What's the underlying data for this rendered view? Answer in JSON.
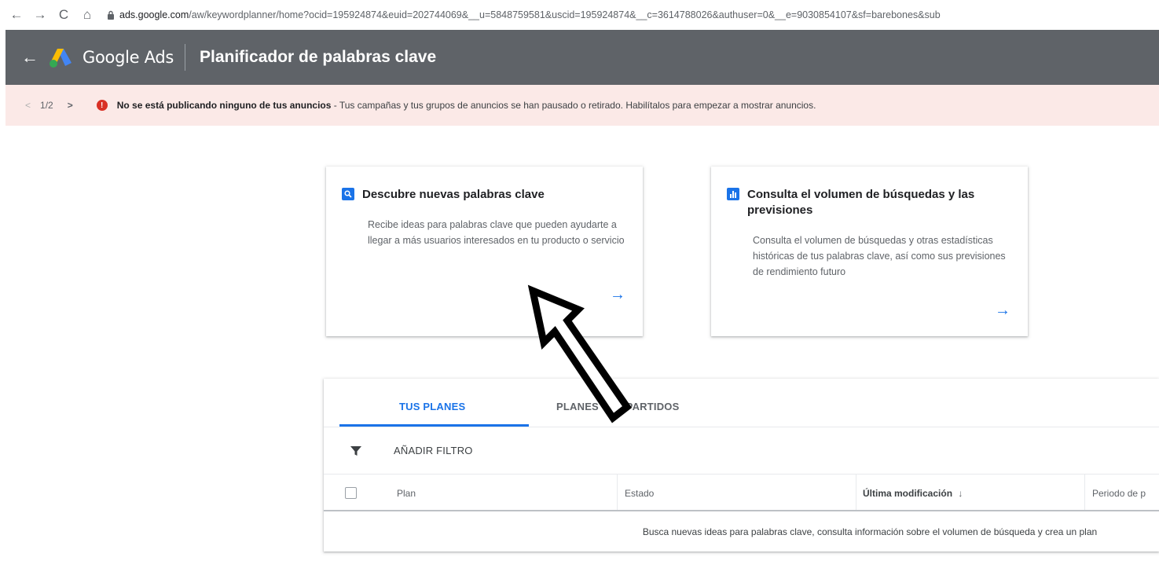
{
  "browser": {
    "back": "←",
    "forward": "→",
    "reload": "C",
    "home": "⌂",
    "url_host": "ads.google.com",
    "url_path": "/aw/keywordplanner/home?ocid=195924874&euid=202744069&__u=5848759581&uscid=195924874&__c=3614788026&authuser=0&__e=9030854107&sf=barebones&sub"
  },
  "header": {
    "back": "←",
    "brand": "Google Ads",
    "title": "Planificador de palabras clave"
  },
  "alert": {
    "pager_prev": "<",
    "pager_count": "1/2",
    "pager_next": ">",
    "icon": "!",
    "bold_text": "No se está publicando ninguno de tus anuncios",
    "text": " - Tus campañas y tus grupos de anuncios se han pausado o retirado. Habilítalos para empezar a mostrar anuncios."
  },
  "cards": [
    {
      "icon": "search-icon",
      "title": "Descubre nuevas palabras clave",
      "description": "Recibe ideas para palabras clave que pueden ayudarte a llegar a más usuarios interesados en tu producto o servicio",
      "arrow": "→"
    },
    {
      "icon": "bar-chart-icon",
      "title": "Consulta el volumen de búsquedas y las previsiones",
      "description": "Consulta el volumen de búsquedas y otras estadísticas históricas de tus palabras clave, así como sus previsiones de rendimiento futuro",
      "arrow": "→"
    }
  ],
  "plans": {
    "tabs": [
      "TUS PLANES",
      "PLANES COMPARTIDOS"
    ],
    "filter_label": "AÑADIR FILTRO",
    "columns": [
      "Plan",
      "Estado",
      "Última modificación",
      "Periodo de p"
    ],
    "sort_indicator": "↓",
    "empty_message": "Busca nuevas ideas para palabras clave, consulta información sobre el volumen de búsqueda y crea un plan"
  },
  "colors": {
    "header_bg": "#5f6368",
    "alert_bg": "#fbe9e7",
    "accent": "#1a73e8",
    "error": "#d93025"
  }
}
